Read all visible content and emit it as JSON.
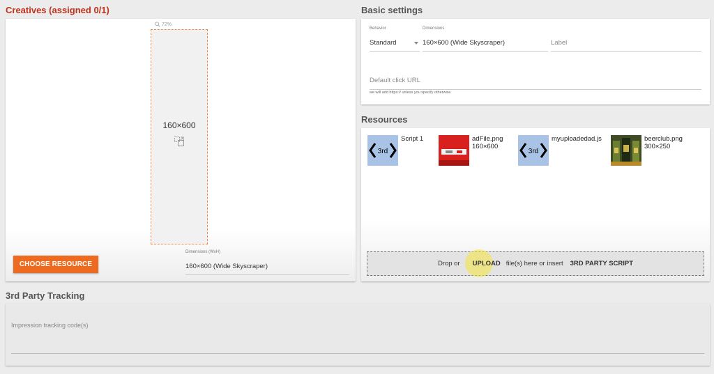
{
  "creatives": {
    "title": "Creatives (assigned 0/1)",
    "zoom": "72%",
    "preview_size": "160×600",
    "choose_button": "CHOOSE RESOURCE",
    "dimensions_label": "Dimensions (WxH)",
    "dimensions_value": "160×600 (Wide Skyscraper)"
  },
  "basic_settings": {
    "title": "Basic settings",
    "behavior_label": "Behavior",
    "behavior_value": "Standard",
    "dimensions_label": "Dimensions",
    "dimensions_value": "160×600 (Wide Skyscraper)",
    "label_placeholder": "Label",
    "click_url_placeholder": "Default click URL",
    "click_url_hint": "we will add https:// unless you specify otherwise"
  },
  "resources": {
    "title": "Resources",
    "items": [
      {
        "name": "Script 1",
        "size": "",
        "thumb_text": "3rd",
        "icon": "third-party-script-icon"
      },
      {
        "name": "adFile.png",
        "size": "160×600",
        "icon": "image-thumbnail"
      },
      {
        "name": "myuploadedad.js",
        "size": "",
        "thumb_text": "3rd",
        "icon": "third-party-script-icon"
      },
      {
        "name": "beerclub.png",
        "size": "300×250",
        "icon": "image-thumbnail"
      }
    ],
    "drop_prefix": "Drop or",
    "drop_upload": "UPLOAD",
    "drop_middle": "file(s) here or insert",
    "drop_script": "3RD PARTY SCRIPT"
  },
  "tracking": {
    "title": "3rd Party Tracking",
    "impression_placeholder": "Impression tracking code(s)"
  },
  "colors": {
    "accent": "#ec6b21",
    "title_red": "#c0311b",
    "script_thumb": "#a8c3e5",
    "preview_border": "#f08a4b"
  }
}
